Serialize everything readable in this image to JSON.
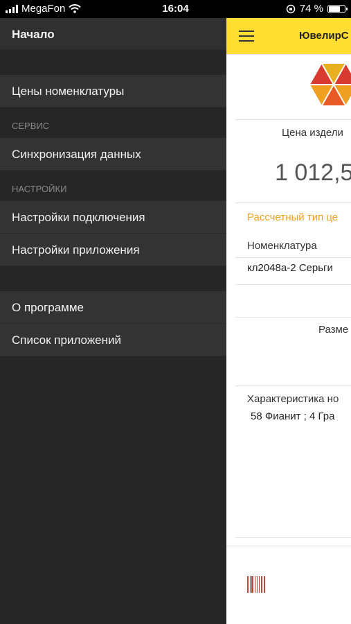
{
  "status_bar": {
    "carrier": "MegaFon",
    "time": "16:04",
    "battery_percent": "74 %",
    "battery_level": 0.74
  },
  "drawer": {
    "home": "Начало",
    "item_prices": "Цены номенклатуры",
    "section_service": "СЕРВИС",
    "item_sync": "Синхронизация данных",
    "section_settings": "НАСТРОЙКИ",
    "item_connection": "Настройки подключения",
    "item_app_settings": "Настройки приложения",
    "item_about": "О программе",
    "item_app_list": "Список приложений"
  },
  "main": {
    "app_title": "ЮвелирС",
    "price_label": "Цена издели",
    "price_value": "1 012,5",
    "calc_type_label": "Рассчетный тип це",
    "nomenclature_label": "Номенклатура",
    "nomenclature_value": "кл2048а-2 Серьги",
    "size_label": "Разме",
    "characteristic_label": "Характеристика но",
    "characteristic_value": "58 Фианит  ; 4 Гра"
  },
  "colors": {
    "drawer_bg": "#262626",
    "drawer_item_bg": "#333333",
    "appbar": "#ffde31",
    "accent_orange": "#f0a020",
    "barcode": "#c2473a"
  },
  "icons": [
    "wifi-icon",
    "orientation-lock-icon",
    "battery-icon",
    "menu-icon",
    "app-logo",
    "barcode-icon"
  ]
}
